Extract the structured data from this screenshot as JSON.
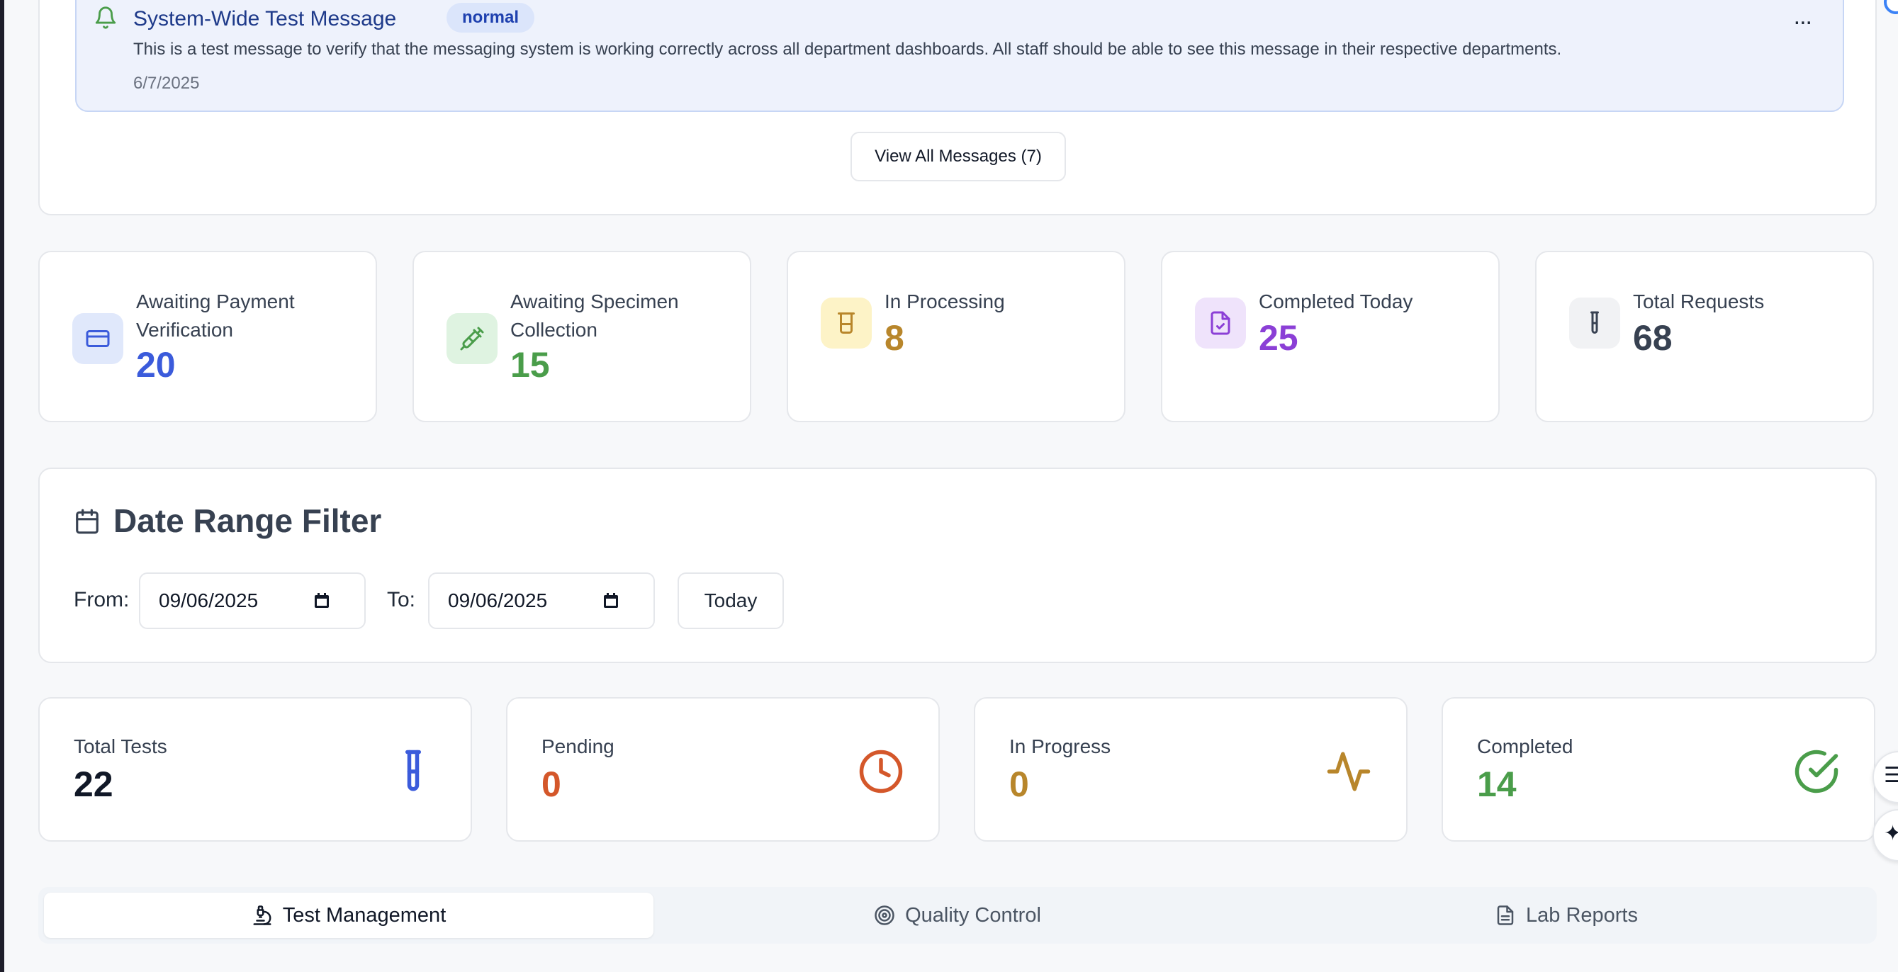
{
  "message": {
    "title": "System-Wide Test Message",
    "badge": "normal",
    "body": "This is a test message to verify that the messaging system is working correctly across all department dashboards. All staff should be able to see this message in their respective departments.",
    "date": "6/7/2025",
    "more_label": "...",
    "view_all_label": "View All Messages (7)",
    "icon": "bell-icon"
  },
  "status_cards": [
    {
      "label": "Awaiting Payment Verification",
      "label_lines": [
        "Awaiting Payment",
        "Verification"
      ],
      "value": "20",
      "icon": "credit-card-icon",
      "color": "#3b5bdb",
      "bg": "#e0e8fb"
    },
    {
      "label": "Awaiting Specimen Collection",
      "label_lines": [
        "Awaiting Specimen",
        "Collection"
      ],
      "value": "15",
      "icon": "syringe-icon",
      "color": "#4a9d4a",
      "bg": "#dff3e1"
    },
    {
      "label": "In Processing",
      "value": "8",
      "icon": "beaker-icon",
      "color": "#b8862b",
      "bg": "#fdf3c7"
    },
    {
      "label": "Completed Today",
      "value": "25",
      "icon": "file-check-icon",
      "color": "#8b3fd6",
      "bg": "#efe3fb"
    },
    {
      "label": "Total Requests",
      "value": "68",
      "icon": "test-tube-icon",
      "color": "#374151",
      "bg": "#f1f2f4"
    }
  ],
  "date_filter": {
    "title": "Date Range Filter",
    "from_label": "From:",
    "from_value": "09/06/2025",
    "to_label": "To:",
    "to_value": "09/06/2025",
    "today_label": "Today",
    "icon": "calendar-icon"
  },
  "summary_cards": [
    {
      "label": "Total Tests",
      "value": "22",
      "icon": "test-tube-icon",
      "color": "#111827",
      "icon_color": "#3b5bdb"
    },
    {
      "label": "Pending",
      "value": "0",
      "icon": "clock-icon",
      "color": "#d4572a",
      "icon_color": "#d4572a"
    },
    {
      "label": "In Progress",
      "value": "0",
      "icon": "activity-icon",
      "color": "#b8862b",
      "icon_color": "#b8862b"
    },
    {
      "label": "Completed",
      "value": "14",
      "icon": "check-circle-icon",
      "color": "#4a9d4a",
      "icon_color": "#4a9d4a"
    }
  ],
  "tabs": [
    {
      "label": "Test Management",
      "icon": "microscope-icon",
      "active": true
    },
    {
      "label": "Quality Control",
      "icon": "target-icon",
      "active": false
    },
    {
      "label": "Lab Reports",
      "icon": "document-icon",
      "active": false
    }
  ]
}
